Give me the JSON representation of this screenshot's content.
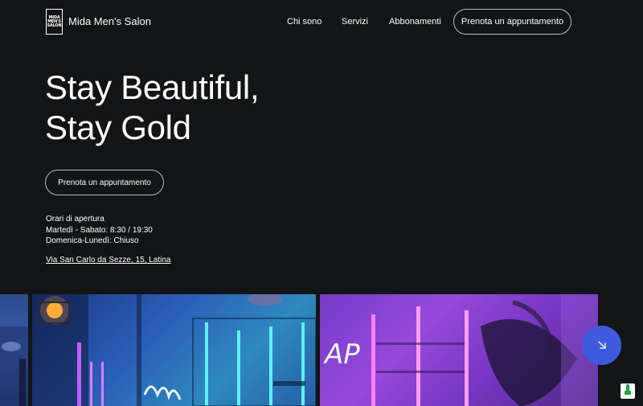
{
  "header": {
    "logo_lines": [
      "MIDA",
      "MEN'S",
      "SALON"
    ],
    "brand": "Mida Men's Salon",
    "nav": [
      "Chi sono",
      "Servizi",
      "Abbonamenti"
    ],
    "cta": "Prenota un appuntamento"
  },
  "hero": {
    "title_line1": "Stay Beautiful,",
    "title_line2": "Stay Gold",
    "cta": "Prenota un appuntamento"
  },
  "hours": {
    "title": "Orari di apertura",
    "line1": "Martedì - Sabato: 8:30 / 19:30",
    "line2": "Domenica-Lunedì: Chiuso"
  },
  "address": "Via San Carlo da Sezze, 15, Latina",
  "colors": {
    "background": "#121416",
    "fab": "#3e5be0"
  },
  "icons": {
    "fab": "arrow-down-right-icon",
    "badge": "shield-icon"
  }
}
